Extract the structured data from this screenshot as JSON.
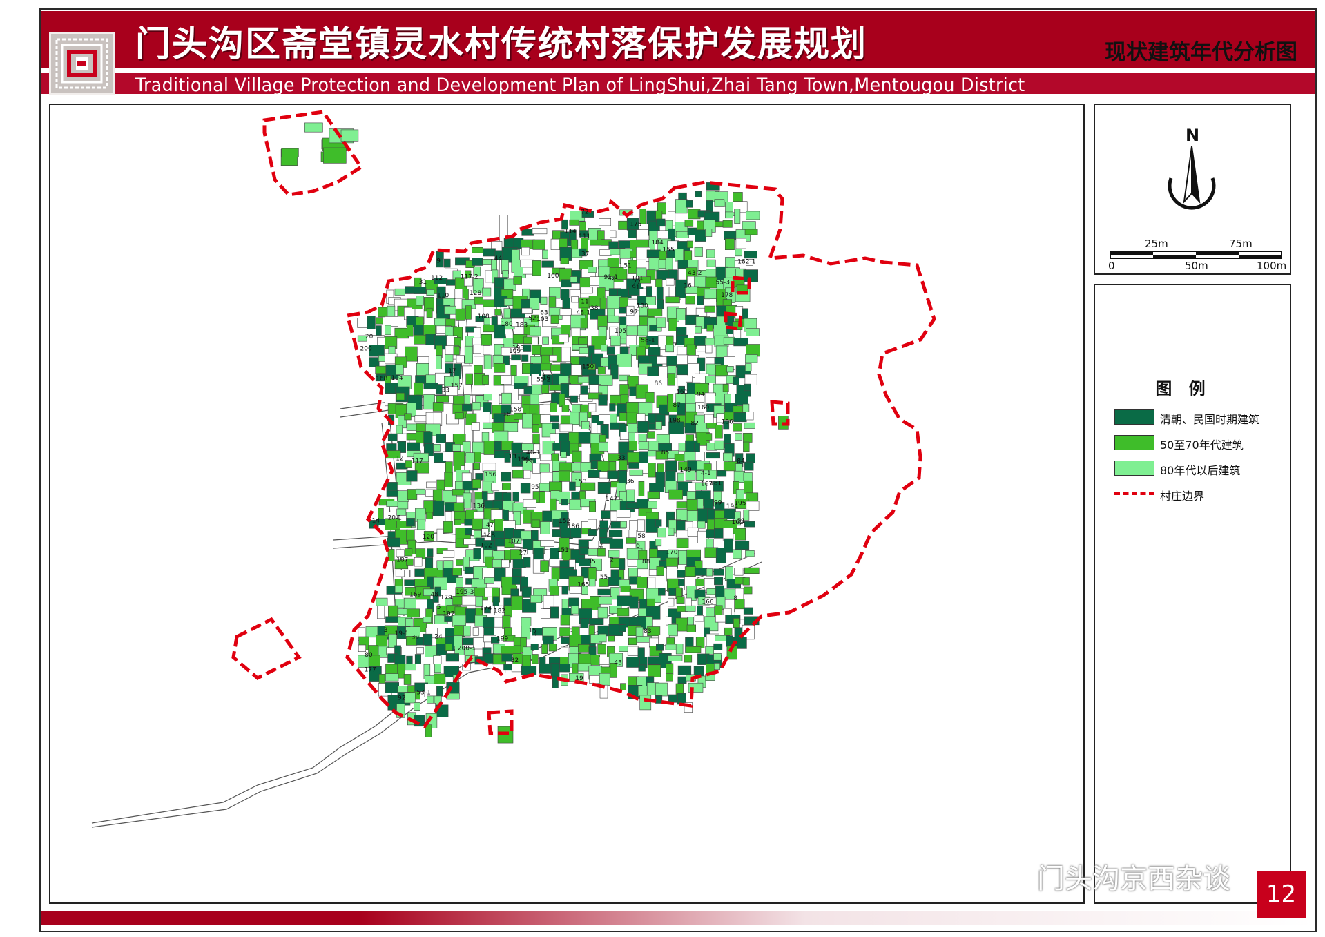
{
  "header": {
    "title_cn": "门头沟区斋堂镇灵水村传统村落保护发展规划",
    "title_en": "Traditional Village Protection and Development Plan of LingShui,Zhai Tang Town,Mentougou District",
    "map_title": "现状建筑年代分析图"
  },
  "compass": {
    "north_label": "N",
    "icon": "north-arrow-icon"
  },
  "scale_bar": {
    "labels_top": [
      "25m",
      "75m"
    ],
    "labels_bottom": [
      "0",
      "50m",
      "100m"
    ]
  },
  "legend": {
    "title": "图 例",
    "items": [
      {
        "label": "清朝、民国时期建筑",
        "color": "#0a6b46",
        "type": "fill"
      },
      {
        "label": "50至70年代建筑",
        "color": "#3fbd2a",
        "type": "fill"
      },
      {
        "label": "80年代以后建筑",
        "color": "#7fef92",
        "type": "fill"
      },
      {
        "label": "村庄边界",
        "color": "#e0000f",
        "type": "dashed-line"
      }
    ]
  },
  "map": {
    "boundary_color": "#e0000f",
    "road_color": "#555555",
    "building_labels": [
      "31",
      "51",
      "52",
      "48-1",
      "48",
      "44",
      "43",
      "46-1",
      "47",
      "53-1",
      "55",
      "39",
      "42",
      "38",
      "37",
      "36",
      "32",
      "33",
      "27",
      "24",
      "91",
      "91-1",
      "20-1",
      "20",
      "19",
      "19-1",
      "18",
      "17",
      "55-3",
      "55-2",
      "43-2",
      "51",
      "85",
      "84",
      "86",
      "87",
      "88",
      "13",
      "14",
      "15",
      "16",
      "58",
      "80",
      "58-1",
      "82",
      "77",
      "72",
      "79",
      "83",
      "95",
      "94",
      "92",
      "12",
      "11",
      "10",
      "9",
      "8",
      "7",
      "6",
      "5",
      "4-1",
      "4",
      "3",
      "2",
      "63",
      "33",
      "35",
      "128",
      "114",
      "120",
      "97",
      "99",
      "102",
      "106",
      "110",
      "111",
      "112",
      "103",
      "100",
      "101",
      "104",
      "105",
      "107",
      "108",
      "109",
      "117",
      "117-2",
      "195-3",
      "130",
      "136",
      "147",
      "148",
      "149",
      "150",
      "151",
      "152",
      "153",
      "155",
      "156",
      "157",
      "158",
      "170",
      "165",
      "162",
      "161",
      "160",
      "166",
      "167",
      "168",
      "169",
      "174",
      "175",
      "177",
      "182-1",
      "183",
      "184",
      "186",
      "187",
      "196",
      "195",
      "192",
      "193",
      "194",
      "198",
      "199",
      "200",
      "200-1",
      "178",
      "179",
      "180",
      "181",
      "182"
    ]
  },
  "footer": {
    "page_number": "12",
    "watermark": "门头沟京西杂谈"
  }
}
